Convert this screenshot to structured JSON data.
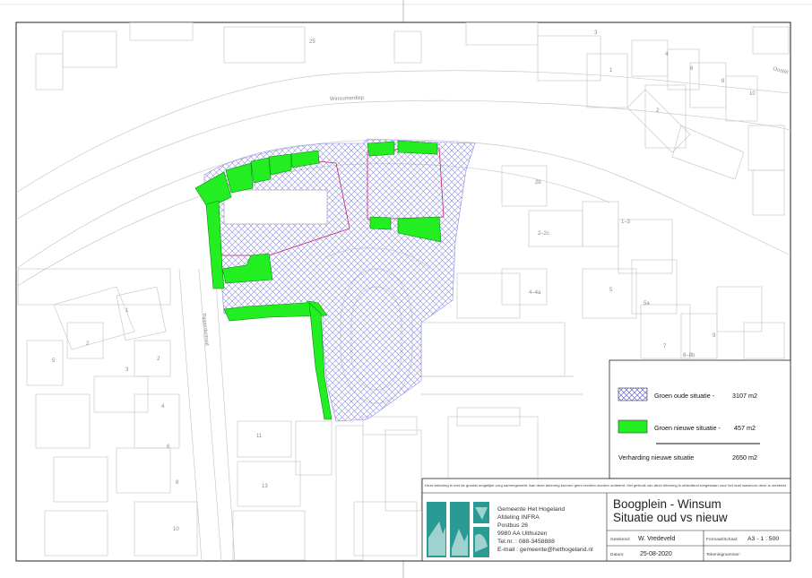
{
  "map": {
    "street_waterway": "Winsumerdiep",
    "street_vertical": "Ripperdastraat",
    "street_top_right": "Oostel",
    "house_numbers": {
      "n25": "25",
      "n1_top": "1",
      "n3": "3",
      "n4_top": "4",
      "n2_top": "2",
      "n6": "6",
      "n8": "8",
      "n10_top": "10",
      "n2b": "2b",
      "n2_2c": "2–2c",
      "n4_4a": "4–4a",
      "n1_3": "1–3",
      "n5": "5",
      "n5a": "5a",
      "n7": "7",
      "n9": "9",
      "n8_8b": "8–8b",
      "n1_left": "1",
      "n2_left": "2",
      "n3_left": "3",
      "n4_left": "4",
      "n5_left": "5",
      "n6_left": "6",
      "n8_left": "8",
      "n10_left": "10",
      "n11": "11",
      "n13": "13"
    }
  },
  "legend": {
    "items": [
      {
        "label": "Groen oude situatie -",
        "value": "3107 m2",
        "swatch": "crosshatch",
        "color": "#8d8de6"
      },
      {
        "label": "Groen nieuwe situatie -",
        "value": "457 m2",
        "swatch": "solid",
        "color": "#22ee22"
      },
      {
        "label": "Verharding nieuwe situatie",
        "value": "2650 m2",
        "swatch": "line",
        "color": "#111111"
      }
    ]
  },
  "disclaimer": "Deze tekening is met de grootst mogelijke zorg samengesteld. Aan deze tekening kunnen geen rechten worden ontleend. Het gebruik van deze tekening is uitsluitend toegestaan voor het doel waarvoor deze is verstrekt.",
  "title_block": {
    "org_name": "Gemeente Het Hogeland",
    "department": "Afdeling INFRA",
    "postbus": "Postbus 26",
    "postcode_city": "9980 AA Uithuizen",
    "phone": "Tel.nr. : 088-3458888",
    "email": "E-mail : gemeente@hethogeland.nl",
    "title_line1": "Boogplein - Winsum",
    "title_line2": "Situatie oud vs nieuw",
    "drawn_by_label": "Getekend:",
    "drawn_by_value": "W. Vredeveld",
    "format_label": "Formaat/Schaal:",
    "format_value": "A3 - 1 : 500",
    "date_label": "Datum:",
    "date_value": "25-08-2020",
    "drawing_number_label": "Tekeningnummer:",
    "drawing_number_value": ""
  },
  "colors": {
    "green_new": "#22ee22",
    "hatch_old": "#8d8de6",
    "old_outline": "#cc2266",
    "logo_teal": "#2a9a95"
  }
}
